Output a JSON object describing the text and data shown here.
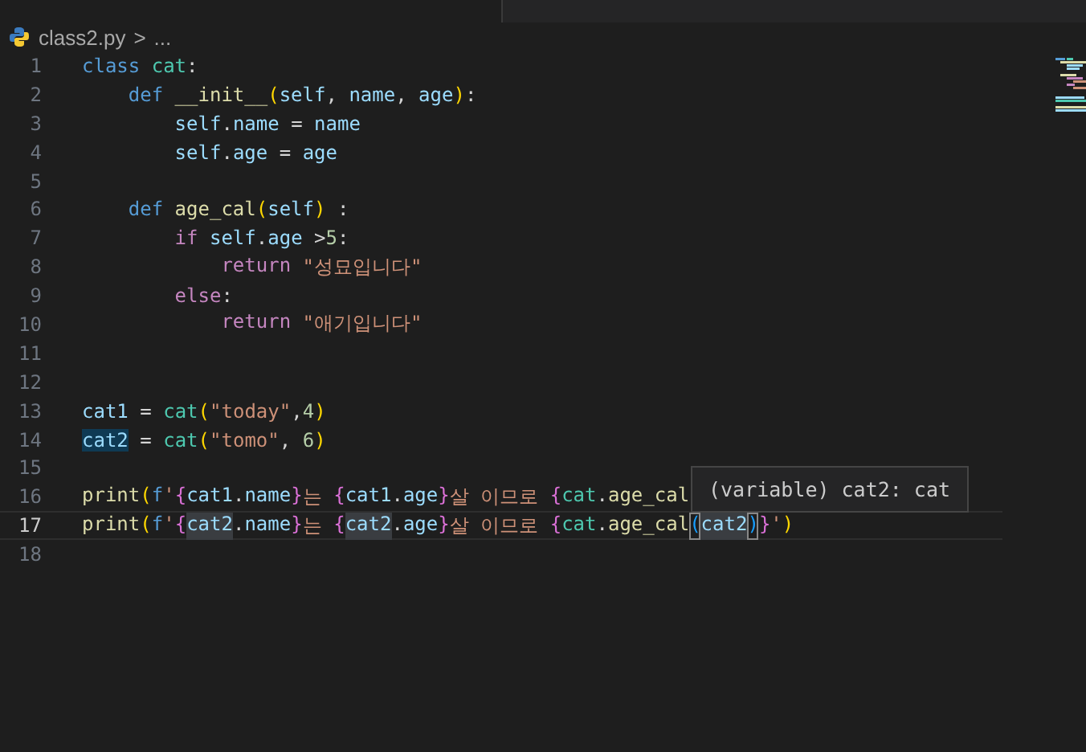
{
  "breadcrumb": {
    "file": "class2.py",
    "separator": ">",
    "rest": "..."
  },
  "lines": [
    {
      "number": "1",
      "current": false,
      "tokens": [
        {
          "text": "class ",
          "color": "#569cd6"
        },
        {
          "text": "cat",
          "color": "#4ec9b0"
        },
        {
          "text": ":",
          "color": "#d4d4d4"
        }
      ]
    },
    {
      "number": "2",
      "current": false,
      "tokens": [
        {
          "text": "    def ",
          "color": "#569cd6"
        },
        {
          "text": "__init__",
          "color": "#dcdcaa"
        },
        {
          "text": "(",
          "color": "#ffd700"
        },
        {
          "text": "self",
          "color": "#9cdcfe"
        },
        {
          "text": ", ",
          "color": "#d4d4d4"
        },
        {
          "text": "name",
          "color": "#9cdcfe"
        },
        {
          "text": ", ",
          "color": "#d4d4d4"
        },
        {
          "text": "age",
          "color": "#9cdcfe"
        },
        {
          "text": ")",
          "color": "#ffd700"
        },
        {
          "text": ":",
          "color": "#d4d4d4"
        }
      ]
    },
    {
      "number": "3",
      "current": false,
      "tokens": [
        {
          "text": "        self",
          "color": "#9cdcfe"
        },
        {
          "text": ".",
          "color": "#d4d4d4"
        },
        {
          "text": "name",
          "color": "#9cdcfe"
        },
        {
          "text": " = ",
          "color": "#d4d4d4"
        },
        {
          "text": "name",
          "color": "#9cdcfe"
        }
      ]
    },
    {
      "number": "4",
      "current": false,
      "tokens": [
        {
          "text": "        self",
          "color": "#9cdcfe"
        },
        {
          "text": ".",
          "color": "#d4d4d4"
        },
        {
          "text": "age",
          "color": "#9cdcfe"
        },
        {
          "text": " = ",
          "color": "#d4d4d4"
        },
        {
          "text": "age",
          "color": "#9cdcfe"
        }
      ]
    },
    {
      "number": "5",
      "current": false
    },
    {
      "number": "6",
      "current": false,
      "tokens": [
        {
          "text": "    def ",
          "color": "#569cd6"
        },
        {
          "text": "age_cal",
          "color": "#dcdcaa"
        },
        {
          "text": "(",
          "color": "#ffd700"
        },
        {
          "text": "self",
          "color": "#9cdcfe"
        },
        {
          "text": ")",
          "color": "#ffd700"
        },
        {
          "text": " :",
          "color": "#d4d4d4"
        }
      ]
    },
    {
      "number": "7",
      "current": false,
      "tokens": [
        {
          "text": "        if ",
          "color": "#c586c0"
        },
        {
          "text": "self",
          "color": "#9cdcfe"
        },
        {
          "text": ".",
          "color": "#d4d4d4"
        },
        {
          "text": "age",
          "color": "#9cdcfe"
        },
        {
          "text": " >",
          "color": "#d4d4d4"
        },
        {
          "text": "5",
          "color": "#b5cea8"
        },
        {
          "text": ":",
          "color": "#d4d4d4"
        }
      ]
    },
    {
      "number": "8",
      "current": false,
      "tokens": [
        {
          "text": "            return ",
          "color": "#c586c0"
        },
        {
          "text": "\"성묘입니다\"",
          "color": "#ce9178"
        }
      ]
    },
    {
      "number": "9",
      "current": false,
      "tokens": [
        {
          "text": "        else",
          "color": "#c586c0"
        },
        {
          "text": ":",
          "color": "#d4d4d4"
        }
      ]
    },
    {
      "number": "10",
      "current": false,
      "tokens": [
        {
          "text": "            return ",
          "color": "#c586c0"
        },
        {
          "text": "\"애기입니다\"",
          "color": "#ce9178"
        }
      ]
    },
    {
      "number": "11",
      "current": false
    },
    {
      "number": "12",
      "current": false
    },
    {
      "number": "13",
      "current": false,
      "tokens": [
        {
          "text": "cat1",
          "color": "#9cdcfe"
        },
        {
          "text": " = ",
          "color": "#d4d4d4"
        },
        {
          "text": "cat",
          "color": "#4ec9b0"
        },
        {
          "text": "(",
          "color": "#ffd700"
        },
        {
          "text": "\"today\"",
          "color": "#ce9178"
        },
        {
          "text": ",",
          "color": "#d4d4d4"
        },
        {
          "text": "4",
          "color": "#b5cea8"
        },
        {
          "text": ")",
          "color": "#ffd700"
        }
      ]
    },
    {
      "number": "14",
      "current": false,
      "tokens": [
        {
          "text": "cat2",
          "kind": "definition"
        },
        {
          "text": " = ",
          "color": "#d4d4d4"
        },
        {
          "text": "cat",
          "color": "#4ec9b0"
        },
        {
          "text": "(",
          "color": "#ffd700"
        },
        {
          "text": "\"tomo\"",
          "color": "#ce9178"
        },
        {
          "text": ", ",
          "color": "#d4d4d4"
        },
        {
          "text": "6",
          "color": "#b5cea8"
        },
        {
          "text": ")",
          "color": "#ffd700"
        }
      ]
    },
    {
      "number": "15",
      "current": false
    },
    {
      "number": "16",
      "current": false,
      "tokens": [
        {
          "text": "print",
          "color": "#dcdcaa"
        },
        {
          "text": "(",
          "color": "#ffd700"
        },
        {
          "text": "f",
          "color": "#569cd6"
        },
        {
          "text": "'",
          "color": "#ce9178"
        },
        {
          "text": "{",
          "color": "#da70d6"
        },
        {
          "text": "cat1",
          "color": "#9cdcfe"
        },
        {
          "text": ".",
          "color": "#d4d4d4"
        },
        {
          "text": "name",
          "color": "#9cdcfe"
        },
        {
          "text": "}",
          "color": "#da70d6"
        },
        {
          "text": "는 ",
          "color": "#ce9178"
        },
        {
          "text": "{",
          "color": "#da70d6"
        },
        {
          "text": "cat1",
          "color": "#9cdcfe"
        },
        {
          "text": ".",
          "color": "#d4d4d4"
        },
        {
          "text": "age",
          "color": "#9cdcfe"
        },
        {
          "text": "}",
          "color": "#da70d6"
        },
        {
          "text": "살 이므로 ",
          "color": "#ce9178"
        },
        {
          "text": "{",
          "color": "#da70d6"
        },
        {
          "text": "cat",
          "color": "#4ec9b0"
        },
        {
          "text": ".",
          "color": "#d4d4d4"
        },
        {
          "text": "age_cal",
          "color": "#dcdcaa"
        }
      ]
    },
    {
      "number": "17",
      "current": true,
      "tokens": [
        {
          "text": "print",
          "color": "#dcdcaa"
        },
        {
          "text": "(",
          "color": "#ffd700"
        },
        {
          "text": "f",
          "color": "#569cd6"
        },
        {
          "text": "'",
          "color": "#ce9178"
        },
        {
          "text": "{",
          "color": "#da70d6"
        },
        {
          "text": "cat2",
          "kind": "reference"
        },
        {
          "text": ".",
          "color": "#d4d4d4"
        },
        {
          "text": "name",
          "color": "#9cdcfe"
        },
        {
          "text": "}",
          "color": "#da70d6"
        },
        {
          "text": "는 ",
          "color": "#ce9178"
        },
        {
          "text": "{",
          "color": "#da70d6"
        },
        {
          "text": "cat2",
          "kind": "reference"
        },
        {
          "text": ".",
          "color": "#d4d4d4"
        },
        {
          "text": "age",
          "color": "#9cdcfe"
        },
        {
          "text": "}",
          "color": "#da70d6"
        },
        {
          "text": "살 이므로 ",
          "color": "#ce9178"
        },
        {
          "text": "{",
          "color": "#da70d6"
        },
        {
          "text": "cat",
          "color": "#4ec9b0"
        },
        {
          "text": ".",
          "color": "#d4d4d4"
        },
        {
          "text": "age_cal",
          "color": "#dcdcaa"
        },
        {
          "text": "(",
          "color": "#179fff",
          "kind": "match"
        },
        {
          "text": "cat2",
          "kind": "reference"
        },
        {
          "text": ")",
          "color": "#179fff",
          "kind": "match"
        },
        {
          "text": "}",
          "color": "#da70d6"
        },
        {
          "text": "'",
          "color": "#ce9178"
        },
        {
          "text": ")",
          "color": "#ffd700"
        }
      ]
    },
    {
      "number": "18",
      "current": false
    }
  ],
  "hover": {
    "text": "(variable) cat2: cat"
  }
}
